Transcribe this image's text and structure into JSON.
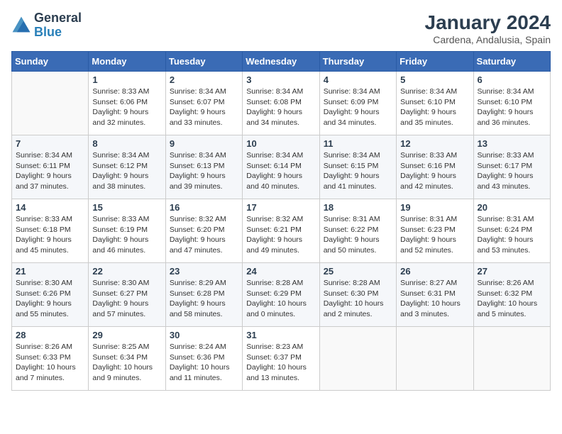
{
  "header": {
    "logo_general": "General",
    "logo_blue": "Blue",
    "month_year": "January 2024",
    "location": "Cardena, Andalusia, Spain"
  },
  "weekdays": [
    "Sunday",
    "Monday",
    "Tuesday",
    "Wednesday",
    "Thursday",
    "Friday",
    "Saturday"
  ],
  "weeks": [
    [
      {
        "day": "",
        "sunrise": "",
        "sunset": "",
        "daylight": ""
      },
      {
        "day": "1",
        "sunrise": "Sunrise: 8:33 AM",
        "sunset": "Sunset: 6:06 PM",
        "daylight": "Daylight: 9 hours and 32 minutes."
      },
      {
        "day": "2",
        "sunrise": "Sunrise: 8:34 AM",
        "sunset": "Sunset: 6:07 PM",
        "daylight": "Daylight: 9 hours and 33 minutes."
      },
      {
        "day": "3",
        "sunrise": "Sunrise: 8:34 AM",
        "sunset": "Sunset: 6:08 PM",
        "daylight": "Daylight: 9 hours and 34 minutes."
      },
      {
        "day": "4",
        "sunrise": "Sunrise: 8:34 AM",
        "sunset": "Sunset: 6:09 PM",
        "daylight": "Daylight: 9 hours and 34 minutes."
      },
      {
        "day": "5",
        "sunrise": "Sunrise: 8:34 AM",
        "sunset": "Sunset: 6:10 PM",
        "daylight": "Daylight: 9 hours and 35 minutes."
      },
      {
        "day": "6",
        "sunrise": "Sunrise: 8:34 AM",
        "sunset": "Sunset: 6:10 PM",
        "daylight": "Daylight: 9 hours and 36 minutes."
      }
    ],
    [
      {
        "day": "7",
        "sunrise": "Sunrise: 8:34 AM",
        "sunset": "Sunset: 6:11 PM",
        "daylight": "Daylight: 9 hours and 37 minutes."
      },
      {
        "day": "8",
        "sunrise": "Sunrise: 8:34 AM",
        "sunset": "Sunset: 6:12 PM",
        "daylight": "Daylight: 9 hours and 38 minutes."
      },
      {
        "day": "9",
        "sunrise": "Sunrise: 8:34 AM",
        "sunset": "Sunset: 6:13 PM",
        "daylight": "Daylight: 9 hours and 39 minutes."
      },
      {
        "day": "10",
        "sunrise": "Sunrise: 8:34 AM",
        "sunset": "Sunset: 6:14 PM",
        "daylight": "Daylight: 9 hours and 40 minutes."
      },
      {
        "day": "11",
        "sunrise": "Sunrise: 8:34 AM",
        "sunset": "Sunset: 6:15 PM",
        "daylight": "Daylight: 9 hours and 41 minutes."
      },
      {
        "day": "12",
        "sunrise": "Sunrise: 8:33 AM",
        "sunset": "Sunset: 6:16 PM",
        "daylight": "Daylight: 9 hours and 42 minutes."
      },
      {
        "day": "13",
        "sunrise": "Sunrise: 8:33 AM",
        "sunset": "Sunset: 6:17 PM",
        "daylight": "Daylight: 9 hours and 43 minutes."
      }
    ],
    [
      {
        "day": "14",
        "sunrise": "Sunrise: 8:33 AM",
        "sunset": "Sunset: 6:18 PM",
        "daylight": "Daylight: 9 hours and 45 minutes."
      },
      {
        "day": "15",
        "sunrise": "Sunrise: 8:33 AM",
        "sunset": "Sunset: 6:19 PM",
        "daylight": "Daylight: 9 hours and 46 minutes."
      },
      {
        "day": "16",
        "sunrise": "Sunrise: 8:32 AM",
        "sunset": "Sunset: 6:20 PM",
        "daylight": "Daylight: 9 hours and 47 minutes."
      },
      {
        "day": "17",
        "sunrise": "Sunrise: 8:32 AM",
        "sunset": "Sunset: 6:21 PM",
        "daylight": "Daylight: 9 hours and 49 minutes."
      },
      {
        "day": "18",
        "sunrise": "Sunrise: 8:31 AM",
        "sunset": "Sunset: 6:22 PM",
        "daylight": "Daylight: 9 hours and 50 minutes."
      },
      {
        "day": "19",
        "sunrise": "Sunrise: 8:31 AM",
        "sunset": "Sunset: 6:23 PM",
        "daylight": "Daylight: 9 hours and 52 minutes."
      },
      {
        "day": "20",
        "sunrise": "Sunrise: 8:31 AM",
        "sunset": "Sunset: 6:24 PM",
        "daylight": "Daylight: 9 hours and 53 minutes."
      }
    ],
    [
      {
        "day": "21",
        "sunrise": "Sunrise: 8:30 AM",
        "sunset": "Sunset: 6:26 PM",
        "daylight": "Daylight: 9 hours and 55 minutes."
      },
      {
        "day": "22",
        "sunrise": "Sunrise: 8:30 AM",
        "sunset": "Sunset: 6:27 PM",
        "daylight": "Daylight: 9 hours and 57 minutes."
      },
      {
        "day": "23",
        "sunrise": "Sunrise: 8:29 AM",
        "sunset": "Sunset: 6:28 PM",
        "daylight": "Daylight: 9 hours and 58 minutes."
      },
      {
        "day": "24",
        "sunrise": "Sunrise: 8:28 AM",
        "sunset": "Sunset: 6:29 PM",
        "daylight": "Daylight: 10 hours and 0 minutes."
      },
      {
        "day": "25",
        "sunrise": "Sunrise: 8:28 AM",
        "sunset": "Sunset: 6:30 PM",
        "daylight": "Daylight: 10 hours and 2 minutes."
      },
      {
        "day": "26",
        "sunrise": "Sunrise: 8:27 AM",
        "sunset": "Sunset: 6:31 PM",
        "daylight": "Daylight: 10 hours and 3 minutes."
      },
      {
        "day": "27",
        "sunrise": "Sunrise: 8:26 AM",
        "sunset": "Sunset: 6:32 PM",
        "daylight": "Daylight: 10 hours and 5 minutes."
      }
    ],
    [
      {
        "day": "28",
        "sunrise": "Sunrise: 8:26 AM",
        "sunset": "Sunset: 6:33 PM",
        "daylight": "Daylight: 10 hours and 7 minutes."
      },
      {
        "day": "29",
        "sunrise": "Sunrise: 8:25 AM",
        "sunset": "Sunset: 6:34 PM",
        "daylight": "Daylight: 10 hours and 9 minutes."
      },
      {
        "day": "30",
        "sunrise": "Sunrise: 8:24 AM",
        "sunset": "Sunset: 6:36 PM",
        "daylight": "Daylight: 10 hours and 11 minutes."
      },
      {
        "day": "31",
        "sunrise": "Sunrise: 8:23 AM",
        "sunset": "Sunset: 6:37 PM",
        "daylight": "Daylight: 10 hours and 13 minutes."
      },
      {
        "day": "",
        "sunrise": "",
        "sunset": "",
        "daylight": ""
      },
      {
        "day": "",
        "sunrise": "",
        "sunset": "",
        "daylight": ""
      },
      {
        "day": "",
        "sunrise": "",
        "sunset": "",
        "daylight": ""
      }
    ]
  ]
}
